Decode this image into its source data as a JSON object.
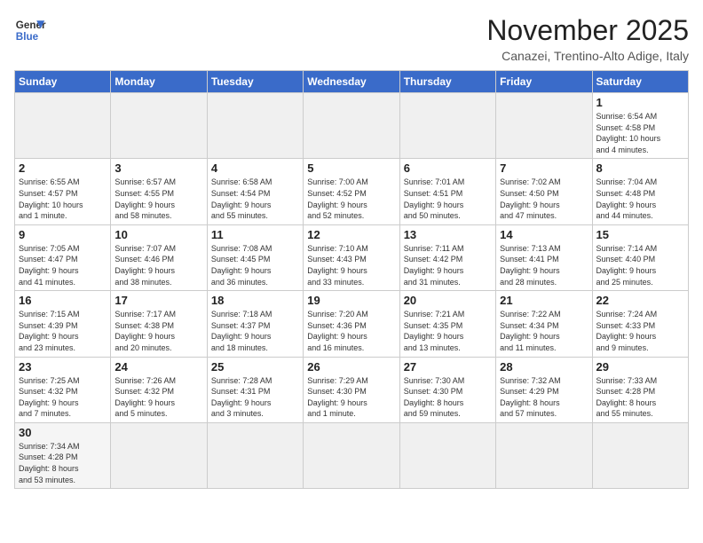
{
  "logo": {
    "line1": "General",
    "line2": "Blue"
  },
  "title": "November 2025",
  "subtitle": "Canazei, Trentino-Alto Adige, Italy",
  "weekdays": [
    "Sunday",
    "Monday",
    "Tuesday",
    "Wednesday",
    "Thursday",
    "Friday",
    "Saturday"
  ],
  "weeks": [
    [
      {
        "day": "",
        "info": ""
      },
      {
        "day": "",
        "info": ""
      },
      {
        "day": "",
        "info": ""
      },
      {
        "day": "",
        "info": ""
      },
      {
        "day": "",
        "info": ""
      },
      {
        "day": "",
        "info": ""
      },
      {
        "day": "1",
        "info": "Sunrise: 6:54 AM\nSunset: 4:58 PM\nDaylight: 10 hours\nand 4 minutes."
      }
    ],
    [
      {
        "day": "2",
        "info": "Sunrise: 6:55 AM\nSunset: 4:57 PM\nDaylight: 10 hours\nand 1 minute."
      },
      {
        "day": "3",
        "info": "Sunrise: 6:57 AM\nSunset: 4:55 PM\nDaylight: 9 hours\nand 58 minutes."
      },
      {
        "day": "4",
        "info": "Sunrise: 6:58 AM\nSunset: 4:54 PM\nDaylight: 9 hours\nand 55 minutes."
      },
      {
        "day": "5",
        "info": "Sunrise: 7:00 AM\nSunset: 4:52 PM\nDaylight: 9 hours\nand 52 minutes."
      },
      {
        "day": "6",
        "info": "Sunrise: 7:01 AM\nSunset: 4:51 PM\nDaylight: 9 hours\nand 50 minutes."
      },
      {
        "day": "7",
        "info": "Sunrise: 7:02 AM\nSunset: 4:50 PM\nDaylight: 9 hours\nand 47 minutes."
      },
      {
        "day": "8",
        "info": "Sunrise: 7:04 AM\nSunset: 4:48 PM\nDaylight: 9 hours\nand 44 minutes."
      }
    ],
    [
      {
        "day": "9",
        "info": "Sunrise: 7:05 AM\nSunset: 4:47 PM\nDaylight: 9 hours\nand 41 minutes."
      },
      {
        "day": "10",
        "info": "Sunrise: 7:07 AM\nSunset: 4:46 PM\nDaylight: 9 hours\nand 38 minutes."
      },
      {
        "day": "11",
        "info": "Sunrise: 7:08 AM\nSunset: 4:45 PM\nDaylight: 9 hours\nand 36 minutes."
      },
      {
        "day": "12",
        "info": "Sunrise: 7:10 AM\nSunset: 4:43 PM\nDaylight: 9 hours\nand 33 minutes."
      },
      {
        "day": "13",
        "info": "Sunrise: 7:11 AM\nSunset: 4:42 PM\nDaylight: 9 hours\nand 31 minutes."
      },
      {
        "day": "14",
        "info": "Sunrise: 7:13 AM\nSunset: 4:41 PM\nDaylight: 9 hours\nand 28 minutes."
      },
      {
        "day": "15",
        "info": "Sunrise: 7:14 AM\nSunset: 4:40 PM\nDaylight: 9 hours\nand 25 minutes."
      }
    ],
    [
      {
        "day": "16",
        "info": "Sunrise: 7:15 AM\nSunset: 4:39 PM\nDaylight: 9 hours\nand 23 minutes."
      },
      {
        "day": "17",
        "info": "Sunrise: 7:17 AM\nSunset: 4:38 PM\nDaylight: 9 hours\nand 20 minutes."
      },
      {
        "day": "18",
        "info": "Sunrise: 7:18 AM\nSunset: 4:37 PM\nDaylight: 9 hours\nand 18 minutes."
      },
      {
        "day": "19",
        "info": "Sunrise: 7:20 AM\nSunset: 4:36 PM\nDaylight: 9 hours\nand 16 minutes."
      },
      {
        "day": "20",
        "info": "Sunrise: 7:21 AM\nSunset: 4:35 PM\nDaylight: 9 hours\nand 13 minutes."
      },
      {
        "day": "21",
        "info": "Sunrise: 7:22 AM\nSunset: 4:34 PM\nDaylight: 9 hours\nand 11 minutes."
      },
      {
        "day": "22",
        "info": "Sunrise: 7:24 AM\nSunset: 4:33 PM\nDaylight: 9 hours\nand 9 minutes."
      }
    ],
    [
      {
        "day": "23",
        "info": "Sunrise: 7:25 AM\nSunset: 4:32 PM\nDaylight: 9 hours\nand 7 minutes."
      },
      {
        "day": "24",
        "info": "Sunrise: 7:26 AM\nSunset: 4:32 PM\nDaylight: 9 hours\nand 5 minutes."
      },
      {
        "day": "25",
        "info": "Sunrise: 7:28 AM\nSunset: 4:31 PM\nDaylight: 9 hours\nand 3 minutes."
      },
      {
        "day": "26",
        "info": "Sunrise: 7:29 AM\nSunset: 4:30 PM\nDaylight: 9 hours\nand 1 minute."
      },
      {
        "day": "27",
        "info": "Sunrise: 7:30 AM\nSunset: 4:30 PM\nDaylight: 8 hours\nand 59 minutes."
      },
      {
        "day": "28",
        "info": "Sunrise: 7:32 AM\nSunset: 4:29 PM\nDaylight: 8 hours\nand 57 minutes."
      },
      {
        "day": "29",
        "info": "Sunrise: 7:33 AM\nSunset: 4:28 PM\nDaylight: 8 hours\nand 55 minutes."
      }
    ],
    [
      {
        "day": "30",
        "info": "Sunrise: 7:34 AM\nSunset: 4:28 PM\nDaylight: 8 hours\nand 53 minutes."
      },
      {
        "day": "",
        "info": ""
      },
      {
        "day": "",
        "info": ""
      },
      {
        "day": "",
        "info": ""
      },
      {
        "day": "",
        "info": ""
      },
      {
        "day": "",
        "info": ""
      },
      {
        "day": "",
        "info": ""
      }
    ]
  ]
}
